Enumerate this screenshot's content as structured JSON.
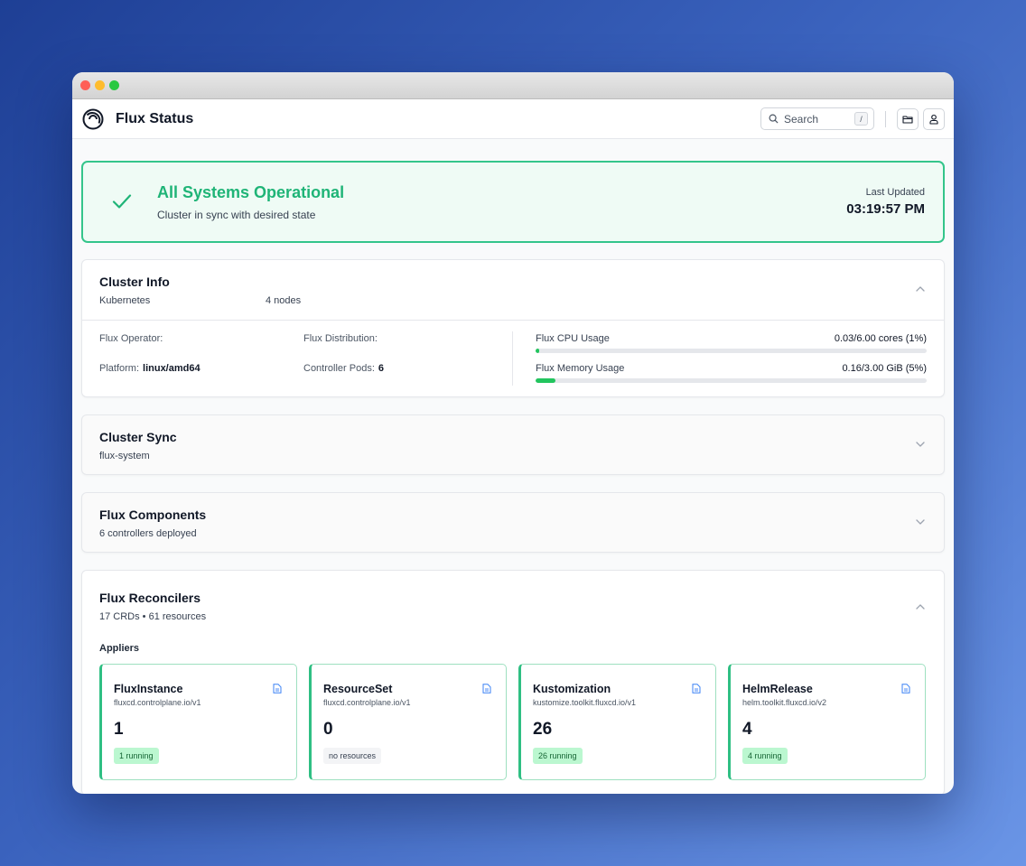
{
  "app": {
    "title": "Flux Status"
  },
  "search": {
    "placeholder": "Search",
    "shortcut": "/"
  },
  "status": {
    "title": "All Systems Operational",
    "subtitle": "Cluster in sync with desired state",
    "last_updated_label": "Last Updated",
    "last_updated_time": "03:19:57 PM"
  },
  "cluster_info": {
    "title": "Cluster Info",
    "platform_name": "Kubernetes",
    "nodes": "4 nodes",
    "operator_label": "Flux Operator:",
    "distribution_label": "Flux Distribution:",
    "platform_label": "Platform:",
    "platform_value": "linux/amd64",
    "pods_label": "Controller Pods:",
    "pods_value": "6",
    "cpu": {
      "label": "Flux CPU Usage",
      "value": "0.03/6.00 cores (1%)",
      "fraction": 0.01
    },
    "memory": {
      "label": "Flux Memory Usage",
      "value": "0.16/3.00 GiB (5%)",
      "fraction": 0.05
    }
  },
  "cluster_sync": {
    "title": "Cluster Sync",
    "subtitle": "flux-system"
  },
  "components": {
    "title": "Flux Components",
    "subtitle": "6 controllers deployed"
  },
  "reconcilers": {
    "title": "Flux Reconcilers",
    "subtitle": "17 CRDs • 61 resources",
    "section_label": "Appliers",
    "tiles": [
      {
        "name": "FluxInstance",
        "api": "fluxcd.controlplane.io/v1",
        "count": "1",
        "badge": "1 running"
      },
      {
        "name": "ResourceSet",
        "api": "fluxcd.controlplane.io/v1",
        "count": "0",
        "badge": "no resources"
      },
      {
        "name": "Kustomization",
        "api": "kustomize.toolkit.fluxcd.io/v1",
        "count": "26",
        "badge": "26 running"
      },
      {
        "name": "HelmRelease",
        "api": "helm.toolkit.fluxcd.io/v2",
        "count": "4",
        "badge": "4 running"
      }
    ]
  },
  "colors": {
    "accent": "#1fb477",
    "status_border": "#34c58b",
    "bar_fill": "#22c55e",
    "doc_icon": "#3b82f6"
  }
}
